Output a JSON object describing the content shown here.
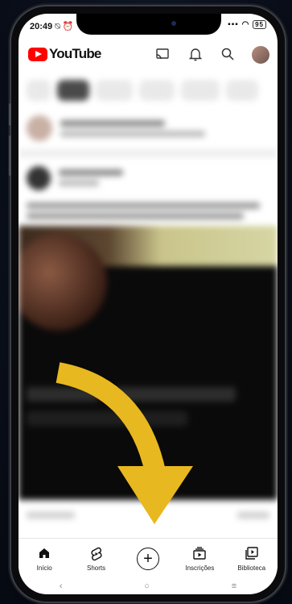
{
  "status": {
    "time": "20:49",
    "left_icons": "⍉ ⏰",
    "right_icons": "▪▪▪ ◠",
    "battery": "95"
  },
  "app": {
    "logo_text": "YouTube"
  },
  "top_icons": {
    "cast": "cast-icon",
    "notifications": "bell-icon",
    "search": "search-icon"
  },
  "bottom_nav": [
    {
      "label": "Início",
      "icon": "home-icon",
      "glyph": "⌂"
    },
    {
      "label": "Shorts",
      "icon": "shorts-icon",
      "glyph": "§"
    },
    {
      "label": "",
      "icon": "create-plus-icon",
      "glyph": "+"
    },
    {
      "label": "Inscrições",
      "icon": "subscriptions-icon",
      "glyph": "▤"
    },
    {
      "label": "Biblioteca",
      "icon": "library-icon",
      "glyph": "▣"
    }
  ],
  "system_nav": {
    "back": "‹",
    "home": "○",
    "menu": "≡"
  },
  "colors": {
    "brand_red": "#ff0000",
    "arrow_yellow": "#e8b820"
  }
}
